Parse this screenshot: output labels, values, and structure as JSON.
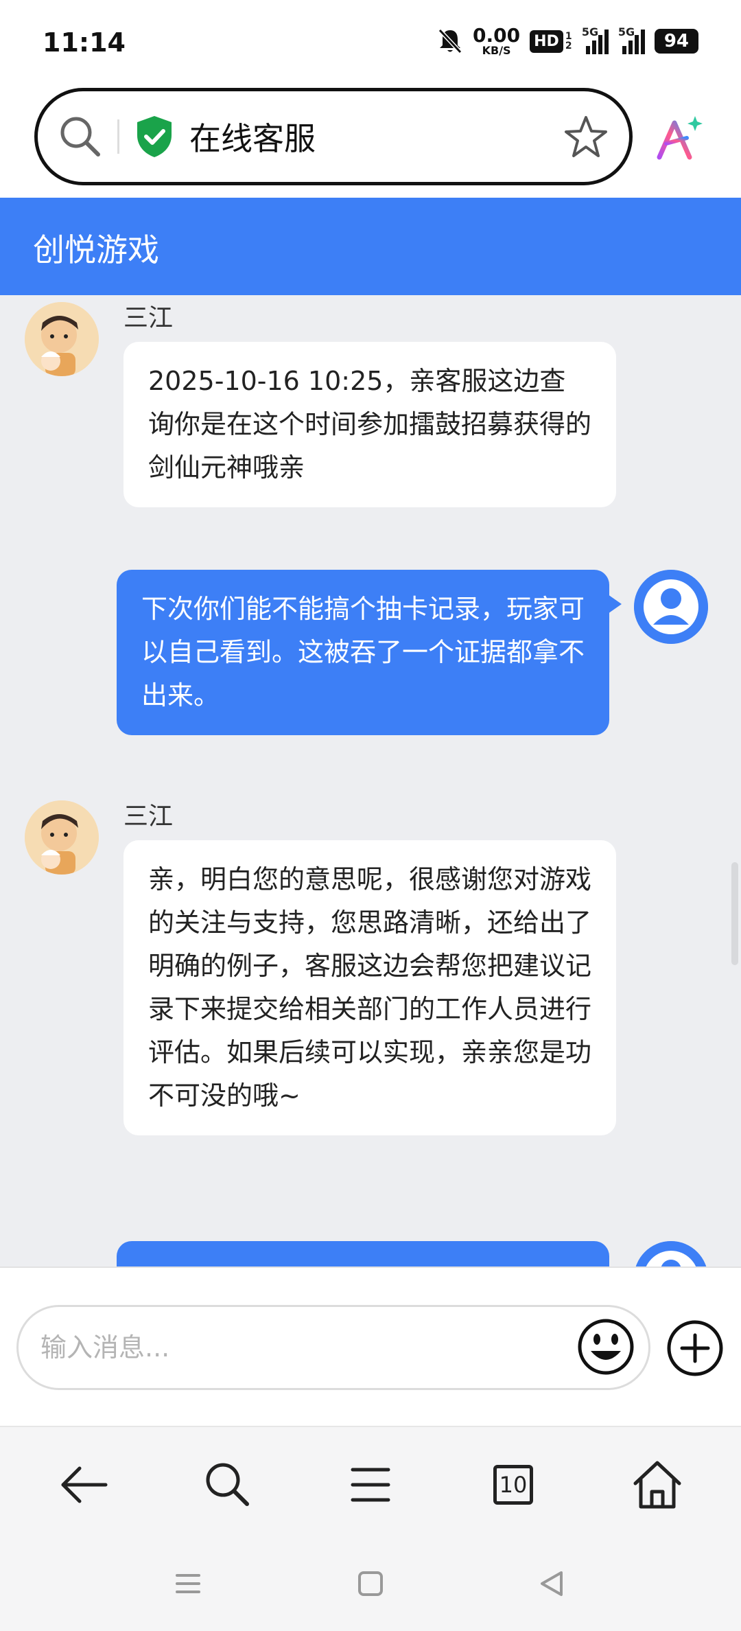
{
  "status_bar": {
    "time": "11:14",
    "net_speed_value": "0.00",
    "net_speed_unit": "KB/S",
    "hd_label": "HD",
    "hd_sub": "1 2",
    "signal1_label": "5G",
    "signal2_label": "5G",
    "battery": "94"
  },
  "browser": {
    "page_title": "在线客服",
    "icons": [
      "search-icon",
      "shield-check-icon",
      "star-icon",
      "ai-assistant-icon"
    ]
  },
  "header": {
    "title": "创悦游戏"
  },
  "messages": [
    {
      "from": "agent",
      "sender": "三江",
      "text": "2025-10-16 10:25，亲客服这边查询你是在这个时间参加擂鼓招募获得的剑仙元神哦亲"
    },
    {
      "from": "user",
      "text": "下次你们能不能搞个抽卡记录，玩家可以自己看到。这被吞了一个证据都拿不出来。"
    },
    {
      "from": "agent",
      "sender": "三江",
      "text": "亲，明白您的意思呢，很感谢您对游戏的关注与支持，您思路清晰，还给出了明确的例子，客服这边会帮您把建议记录下来提交给相关部门的工作人员进行评估。如果后续可以实现，亲亲您是功不可没的哦~"
    },
    {
      "from": "user",
      "text": ""
    }
  ],
  "input": {
    "placeholder": "输入消息...",
    "value": ""
  },
  "nav": {
    "tab_count": "10"
  },
  "colors": {
    "accent": "#3d7ff6",
    "chat_bg": "#edeef1",
    "shield": "#1aa34a"
  }
}
